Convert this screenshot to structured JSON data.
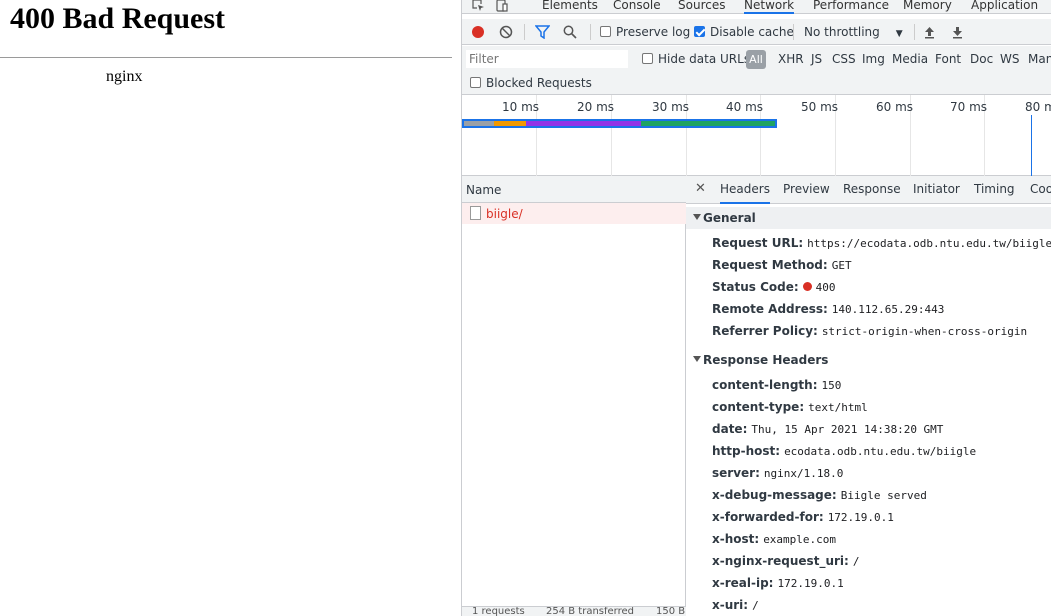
{
  "page": {
    "heading": "400 Bad Request",
    "server": "nginx"
  },
  "devtools": {
    "tabs": [
      {
        "label": "Elements"
      },
      {
        "label": "Console"
      },
      {
        "label": "Sources"
      },
      {
        "label": "Network"
      },
      {
        "label": "Performance"
      },
      {
        "label": "Memory"
      },
      {
        "label": "Application"
      }
    ],
    "active_tab": "Network",
    "toolbar": {
      "preserve_log": "Preserve log",
      "preserve_log_checked": false,
      "disable_cache": "Disable cache",
      "disable_cache_checked": true,
      "throttling": "No throttling"
    },
    "filter": {
      "placeholder": "Filter",
      "hide_data_urls": "Hide data URLs",
      "all": "All",
      "types": [
        "XHR",
        "JS",
        "CSS",
        "Img",
        "Media",
        "Font",
        "Doc",
        "WS",
        "Man"
      ]
    },
    "blocked_requests": "Blocked Requests",
    "overview": {
      "ticks": [
        "10 ms",
        "20 ms",
        "30 ms",
        "40 ms",
        "50 ms",
        "60 ms",
        "70 ms",
        "80 m"
      ],
      "colors": {
        "queue": "#9aa0a6",
        "ssl": "#f29900",
        "ttfb": "#9334e6",
        "download": "#1ea362"
      }
    },
    "request_list": {
      "column": "Name",
      "rows": [
        {
          "name": "biigle/"
        }
      ],
      "footer": [
        "1 requests",
        "254 B transferred",
        "150 B"
      ]
    },
    "detail": {
      "tabs": [
        "Headers",
        "Preview",
        "Response",
        "Initiator",
        "Timing",
        "Coo"
      ],
      "active_tab": "Headers",
      "general_title": "General",
      "general": [
        {
          "key": "Request URL:",
          "value": "https://ecodata.odb.ntu.edu.tw/biigle/"
        },
        {
          "key": "Request Method:",
          "value": "GET"
        },
        {
          "key": "Status Code:",
          "value": "400"
        },
        {
          "key": "Remote Address:",
          "value": "140.112.65.29:443"
        },
        {
          "key": "Referrer Policy:",
          "value": "strict-origin-when-cross-origin"
        }
      ],
      "response_title": "Response Headers",
      "response": [
        {
          "key": "content-length:",
          "value": "150"
        },
        {
          "key": "content-type:",
          "value": "text/html"
        },
        {
          "key": "date:",
          "value": "Thu, 15 Apr 2021 14:38:20 GMT"
        },
        {
          "key": "http-host:",
          "value": "ecodata.odb.ntu.edu.tw/biigle"
        },
        {
          "key": "server:",
          "value": "nginx/1.18.0"
        },
        {
          "key": "x-debug-message:",
          "value": "Biigle served"
        },
        {
          "key": "x-forwarded-for:",
          "value": "172.19.0.1"
        },
        {
          "key": "x-host:",
          "value": "example.com"
        },
        {
          "key": "x-nginx-request_uri:",
          "value": "/"
        },
        {
          "key": "x-real-ip:",
          "value": "172.19.0.1"
        },
        {
          "key": "x-uri:",
          "value": "/"
        }
      ]
    }
  }
}
